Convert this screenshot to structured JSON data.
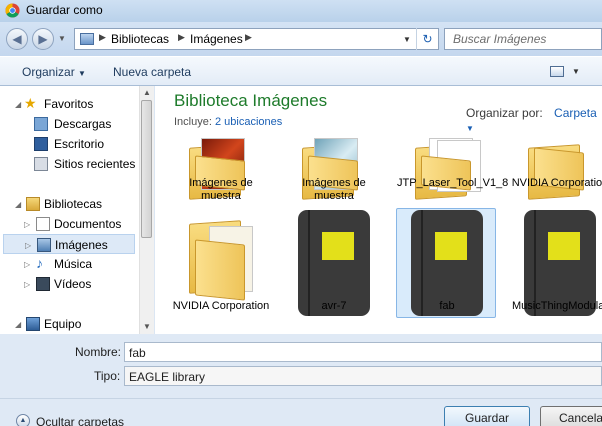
{
  "window": {
    "title": "Guardar como"
  },
  "nav": {
    "breadcrumb": [
      "Bibliotecas",
      "Imágenes"
    ],
    "search_placeholder": "Buscar Imágenes"
  },
  "toolbar": {
    "organize": "Organizar",
    "new_folder": "Nueva carpeta"
  },
  "sidebar": {
    "favorites": "Favoritos",
    "descargas": "Descargas",
    "escritorio": "Escritorio",
    "recientes": "Sitios recientes",
    "bibliotecas": "Bibliotecas",
    "documentos": "Documentos",
    "imagenes": "Imágenes",
    "musica": "Música",
    "videos": "Vídeos",
    "equipo": "Equipo"
  },
  "main": {
    "title": "Biblioteca Imágenes",
    "includes_label": "Incluye:",
    "includes_link": "2 ubicaciones",
    "arrange_label": "Organizar por:",
    "arrange_value": "Carpeta",
    "items": [
      {
        "name": "Imágenes de muestra",
        "kind": "folder-photos"
      },
      {
        "name": "Imágenes de muestra",
        "kind": "folder-photos"
      },
      {
        "name": "JTP_Laser_Tool_V1_8",
        "kind": "folder-docs"
      },
      {
        "name": "NVIDIA Corporation",
        "kind": "folder"
      },
      {
        "name": "NVIDIA Corporation",
        "kind": "folder"
      },
      {
        "name": "avr-7",
        "kind": "notebook-file"
      },
      {
        "name": "fab",
        "kind": "notebook-file",
        "selected": true
      },
      {
        "name": "MusicThingModular",
        "kind": "notebook-file"
      }
    ]
  },
  "form": {
    "name_label": "Nombre:",
    "name_value": "fab",
    "type_label": "Tipo:",
    "type_value": "EAGLE library"
  },
  "footer": {
    "hide_folders": "Ocultar carpetas",
    "save": "Guardar",
    "cancel": "Cancelar"
  },
  "colors": {
    "library_title": "#1e7b2b",
    "link": "#1a5fb4",
    "notebook_square": "#e3e01a"
  }
}
